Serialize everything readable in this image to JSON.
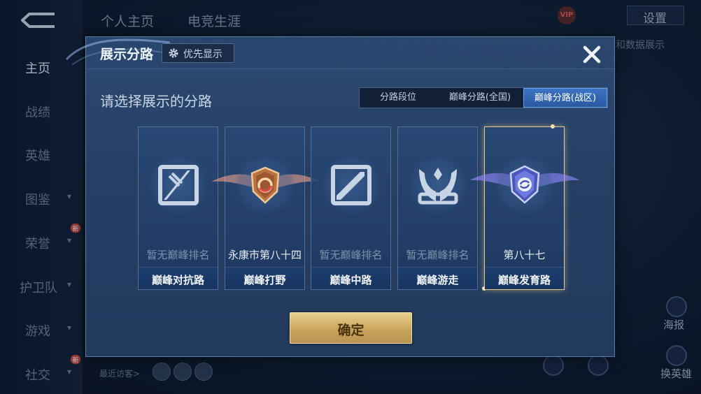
{
  "sidebar": {
    "items": [
      {
        "label": "主页",
        "active": true,
        "chevron": false,
        "new": false
      },
      {
        "label": "战绩",
        "active": false,
        "chevron": false,
        "new": false
      },
      {
        "label": "英雄",
        "active": false,
        "chevron": false,
        "new": false
      },
      {
        "label": "图鉴",
        "active": false,
        "chevron": true,
        "new": false
      },
      {
        "label": "荣誉",
        "active": false,
        "chevron": true,
        "new": true
      },
      {
        "label": "护卫队",
        "active": false,
        "chevron": true,
        "new": false
      },
      {
        "label": "游戏",
        "active": false,
        "chevron": true,
        "new": false
      },
      {
        "label": "社交",
        "active": false,
        "chevron": true,
        "new": true
      }
    ],
    "new_badge": "新"
  },
  "top_tabs": [
    "个人主页",
    "电竞生涯"
  ],
  "top_bar": {
    "settings": "设置",
    "vip": "VIP"
  },
  "background": {
    "right_text": "和数据展示",
    "poster": "海报",
    "switch_hero": "换英雄",
    "visitors": "最近访客>"
  },
  "dialog": {
    "title": "展示分路",
    "priority_button": "优先显示",
    "subtitle": "请选择展示的分路",
    "segments": [
      "分路段位",
      "巅峰分路(全国)",
      "巅峰分路(战区)"
    ],
    "selected_segment": "巅峰分路(战区)",
    "lanes": [
      {
        "rank": "暂无巅峰排名",
        "name": "巅峰对抗路",
        "has_rank": false,
        "selected": false,
        "icon": "top-lane-icon"
      },
      {
        "rank": "永康市第八十四",
        "name": "巅峰打野",
        "has_rank": true,
        "selected": false,
        "icon": "jungle-crest-icon"
      },
      {
        "rank": "暂无巅峰排名",
        "name": "巅峰中路",
        "has_rank": false,
        "selected": false,
        "icon": "mid-lane-icon"
      },
      {
        "rank": "暂无巅峰排名",
        "name": "巅峰游走",
        "has_rank": false,
        "selected": false,
        "icon": "roam-wings-icon"
      },
      {
        "rank": "第八十七",
        "name": "巅峰发育路",
        "has_rank": true,
        "selected": true,
        "icon": "adc-crest-icon"
      }
    ],
    "confirm": "确定"
  },
  "colors": {
    "dialog_bg": "#2a4870",
    "selected_border": "#e5c98d",
    "segment_active": "#3b74c4",
    "confirm_gold": "#d6b46d"
  }
}
